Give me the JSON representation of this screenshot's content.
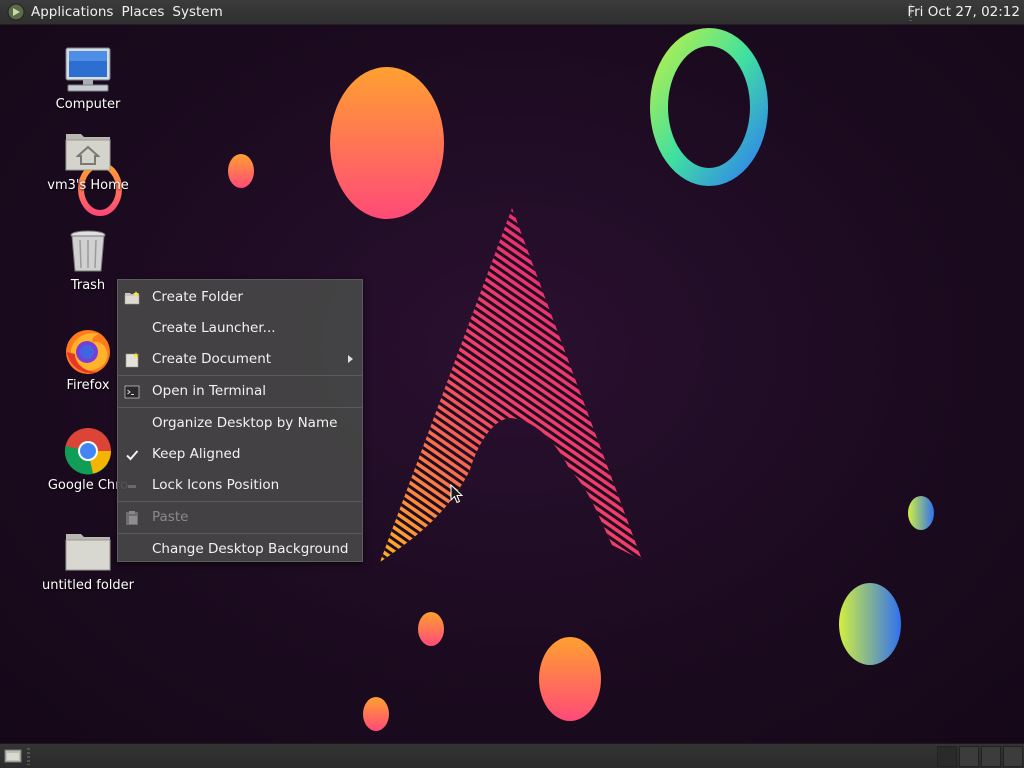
{
  "top_panel": {
    "menus": [
      "Applications",
      "Places",
      "System"
    ],
    "clock": "Fri Oct 27, 02:12"
  },
  "desktop": {
    "icons": [
      {
        "label": "Computer",
        "icon": "computer-icon"
      },
      {
        "label": "vm3's Home",
        "icon": "home-folder-icon"
      },
      {
        "label": "Trash",
        "icon": "trash-icon"
      },
      {
        "label": "Firefox",
        "icon": "firefox-icon"
      },
      {
        "label": "Google Chro",
        "icon": "chrome-icon"
      },
      {
        "label": "untitled folder",
        "icon": "folder-icon"
      }
    ]
  },
  "context_menu": {
    "items": [
      {
        "label": "Create Folder",
        "icon": "new-folder-icon",
        "enabled": true
      },
      {
        "label": "Create Launcher...",
        "enabled": true
      },
      {
        "label": "Create Document",
        "icon": "new-document-icon",
        "submenu": true,
        "enabled": true
      },
      {
        "label": "Open in Terminal",
        "icon": "terminal-icon",
        "enabled": true
      },
      {
        "label": "Organize Desktop by Name",
        "enabled": true
      },
      {
        "label": "Keep Aligned",
        "checked": true,
        "enabled": true
      },
      {
        "label": "Lock Icons Position",
        "checked": false,
        "enabled": true
      },
      {
        "label": "Paste",
        "icon": "paste-icon",
        "enabled": false
      },
      {
        "label": "Change Desktop Background",
        "enabled": true
      }
    ]
  },
  "colors": {
    "panel_bg": "#333333",
    "menu_bg": "#464646",
    "wallpaper_bg": "#1d0c1f",
    "arch_pink": "#e8226f"
  }
}
